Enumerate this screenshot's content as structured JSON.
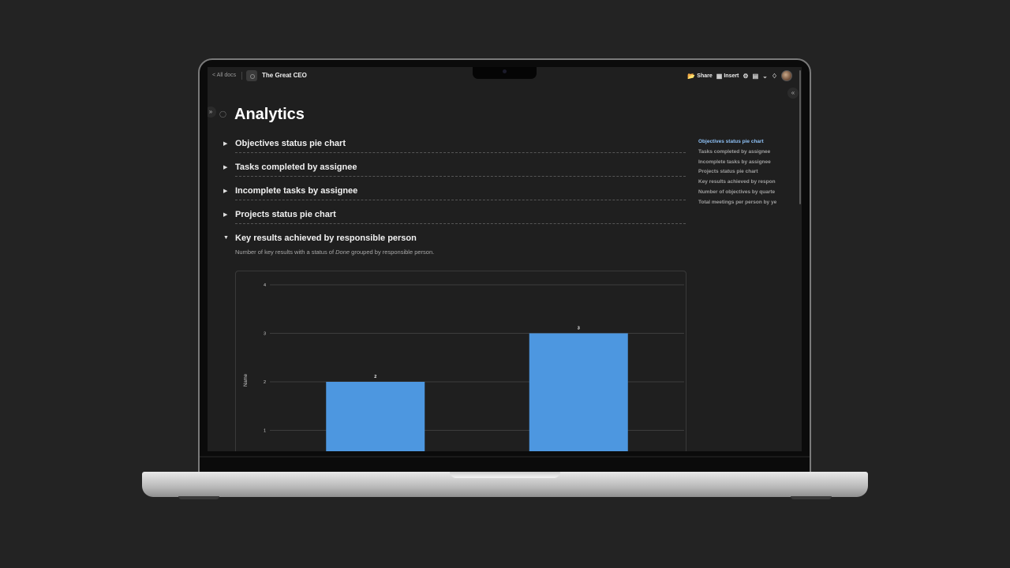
{
  "topbar": {
    "back_label": "< All docs",
    "doc_title": "The Great CEO",
    "share_label": "Share",
    "insert_label": "Insert"
  },
  "page": {
    "title": "Analytics"
  },
  "sections": [
    {
      "title": "Objectives status pie chart",
      "expanded": false
    },
    {
      "title": "Tasks completed by assignee",
      "expanded": false
    },
    {
      "title": "Incomplete tasks by assignee",
      "expanded": false
    },
    {
      "title": "Projects status pie chart",
      "expanded": false
    },
    {
      "title": "Key results achieved by responsible person",
      "expanded": true
    }
  ],
  "description": {
    "prefix": "Number of key results with a status of ",
    "emphasis": "Done",
    "suffix": " grouped by responsible person."
  },
  "toc": {
    "items": [
      "Objectives status pie chart",
      "Tasks completed by assignee",
      "Incomplete tasks by assignee",
      "Projects status pie chart",
      "Key results achieved by respon",
      "Number of objectives by quarte",
      "Total meetings per person by ye"
    ],
    "active_index": 0
  },
  "colors": {
    "bar": "#4d97e0",
    "toc_active": "#8ec1f6"
  },
  "chart_data": {
    "type": "bar",
    "categories": [
      "",
      ""
    ],
    "values": [
      2,
      3
    ],
    "data_labels": [
      "2",
      "3"
    ],
    "ylabel": "Name",
    "xlabel": "",
    "yticks": [
      "1",
      "2",
      "3",
      "4"
    ],
    "ylim": [
      0,
      4
    ],
    "grid": true
  }
}
